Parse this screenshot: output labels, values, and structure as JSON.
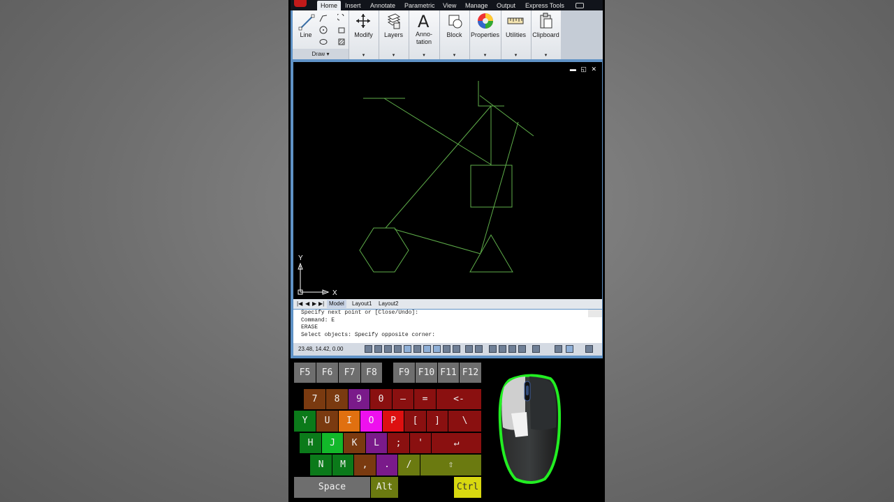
{
  "ribbon": {
    "tabs": [
      "Home",
      "Insert",
      "Annotate",
      "Parametric",
      "View",
      "Manage",
      "Output",
      "Express Tools"
    ],
    "active_tab": "Home",
    "panels": {
      "line": "Line",
      "draw": "Draw",
      "modify": "Modify",
      "layers": "Layers",
      "annotation": "Anno-\ntation",
      "block": "Block",
      "properties": "Properties",
      "utilities": "Utilities",
      "clipboard": "Clipboard"
    },
    "dropdown_glyph": "▾"
  },
  "viewport": {
    "controls": [
      "▬",
      "◱",
      "✕"
    ],
    "ucs": {
      "y": "Y",
      "x": "X"
    }
  },
  "layout_tabs": {
    "nav": [
      "|◀",
      "◀",
      "▶",
      "▶|"
    ],
    "tabs": [
      "Model",
      "Layout1",
      "Layout2"
    ],
    "active": "Model"
  },
  "command_line": [
    "Specify next point or [Close/Undo]:",
    "Command: E",
    "ERASE",
    "Select objects: Specify opposite corner:"
  ],
  "statusbar": {
    "coordinates": "23.48, 14.42, 0.00"
  },
  "keyboard": {
    "fkeys": [
      {
        "label": "F5",
        "color": "#6e6e6e"
      },
      {
        "label": "F6",
        "color": "#6e6e6e"
      },
      {
        "label": "F7",
        "color": "#6e6e6e"
      },
      {
        "label": "F8",
        "color": "#6e6e6e"
      },
      {
        "label": "F9",
        "color": "#6e6e6e"
      },
      {
        "label": "F10",
        "color": "#6e6e6e"
      },
      {
        "label": "F11",
        "color": "#6e6e6e"
      },
      {
        "label": "F12",
        "color": "#6e6e6e"
      }
    ],
    "row1": [
      {
        "label": "7",
        "color": "#7a3a10"
      },
      {
        "label": "8",
        "color": "#7a3a10"
      },
      {
        "label": "9",
        "color": "#7a1a8a"
      },
      {
        "label": "0",
        "color": "#8a1010"
      },
      {
        "label": "–",
        "color": "#8a1010"
      },
      {
        "label": "=",
        "color": "#8a1010"
      },
      {
        "label": "<-",
        "color": "#8a1010"
      }
    ],
    "row2": [
      {
        "label": "Y",
        "color": "#0b7a1a"
      },
      {
        "label": "U",
        "color": "#7a3a10"
      },
      {
        "label": "I",
        "color": "#e07010"
      },
      {
        "label": "O",
        "color": "#ee10ee"
      },
      {
        "label": "P",
        "color": "#dd1010"
      },
      {
        "label": "[",
        "color": "#8a1010"
      },
      {
        "label": "]",
        "color": "#8a1010"
      },
      {
        "label": "\\",
        "color": "#8a1010"
      }
    ],
    "row3": [
      {
        "label": "H",
        "color": "#0b7a1a"
      },
      {
        "label": "J",
        "color": "#12b82a"
      },
      {
        "label": "K",
        "color": "#7a3a10"
      },
      {
        "label": "L",
        "color": "#7a1a8a"
      },
      {
        "label": ";",
        "color": "#8a1010"
      },
      {
        "label": "'",
        "color": "#8a1010"
      },
      {
        "label": "↵",
        "color": "#8a1010"
      }
    ],
    "row4": [
      {
        "label": "N",
        "color": "#0b7a1a"
      },
      {
        "label": "M",
        "color": "#0b7a1a"
      },
      {
        "label": ",",
        "color": "#7a3a10"
      },
      {
        "label": ".",
        "color": "#7a1a8a"
      },
      {
        "label": "/",
        "color": "#6b7a10"
      },
      {
        "label": "⇧",
        "color": "#6b7a10"
      }
    ],
    "row5": [
      {
        "label": "Space",
        "color": "#6e6e6e"
      },
      {
        "label": "Alt",
        "color": "#6b7a10"
      },
      {
        "label": "Ctrl",
        "color": "#d8d810"
      }
    ]
  },
  "colors": {
    "drawing_line": "#5fae4a",
    "ucs": "#ffffff",
    "mouse_glow": "#22ee22"
  }
}
